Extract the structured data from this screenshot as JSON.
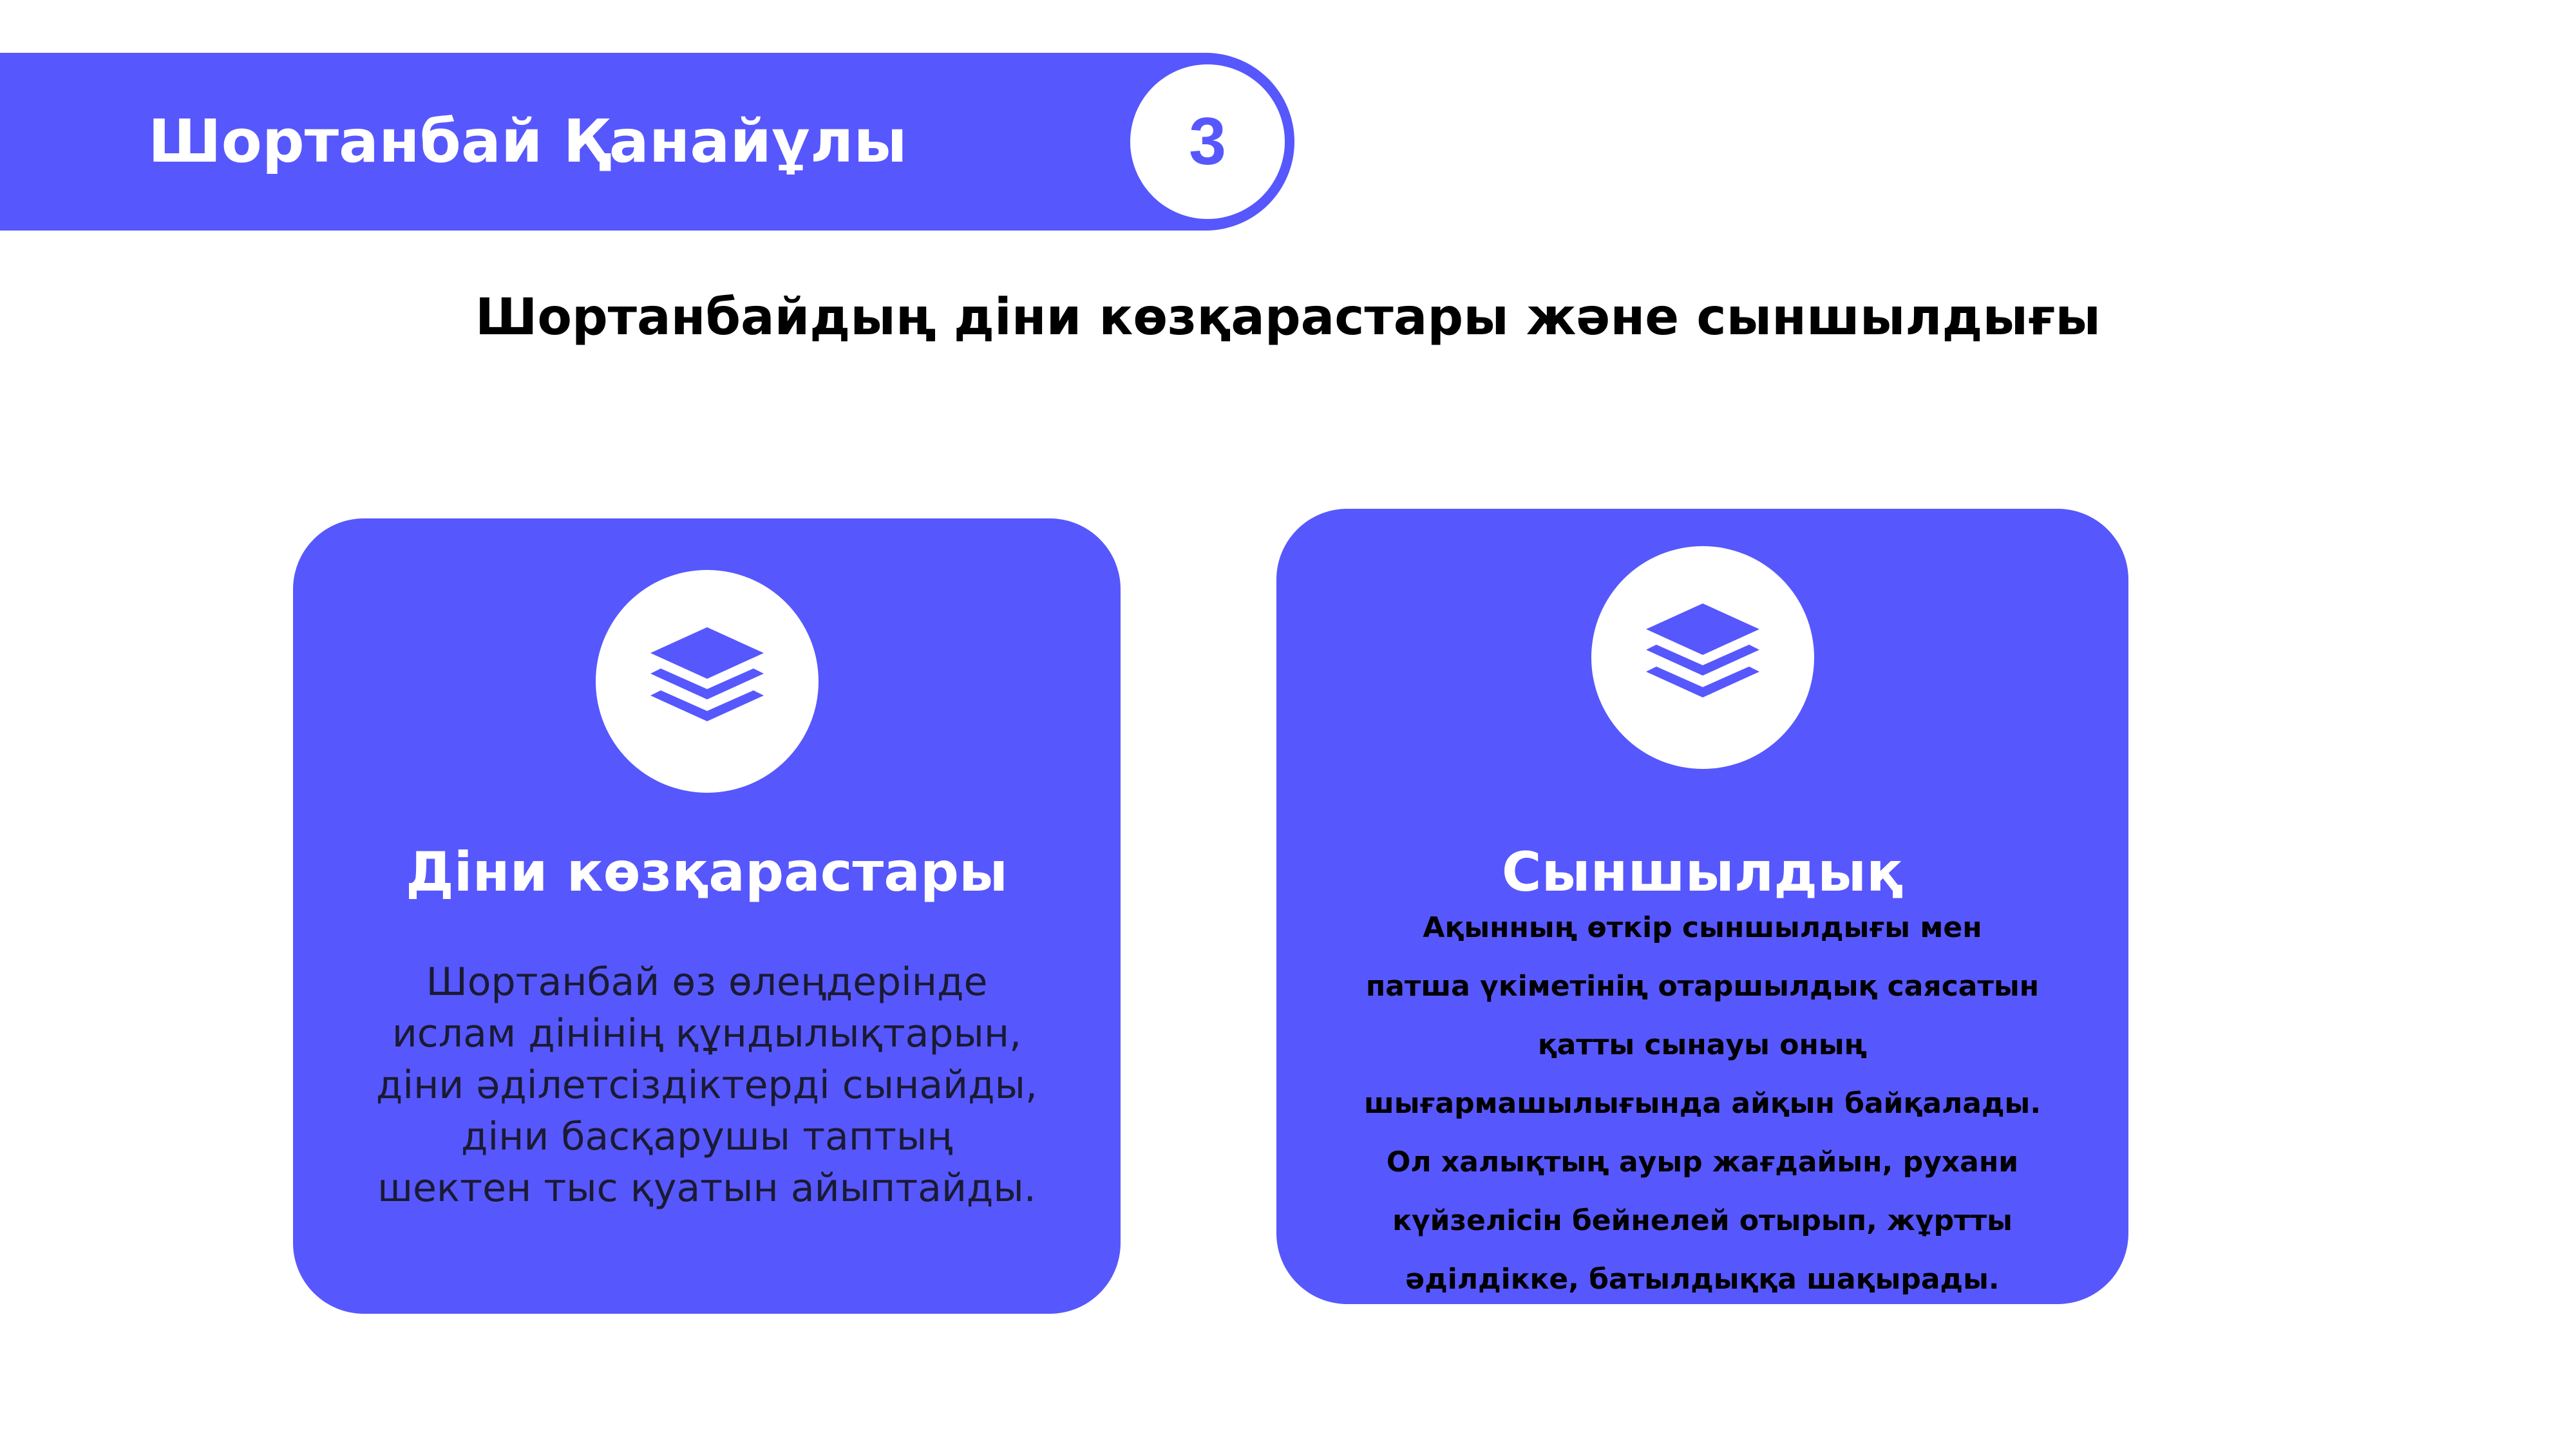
{
  "header": {
    "title": "Шортанбай Қанайұлы",
    "number": "3"
  },
  "subtitle": "Шортанбайдың діни көзқарастары және сыншылдығы",
  "cards": [
    {
      "icon": "layers-icon",
      "title": "Діни көзқарастары",
      "text_lines": [
        "Шортанбай өз өлеңдерінде",
        "ислам дінінің құндылықтарын,",
        "діни әділетсіздіктерді сынайды,",
        "діни басқарушы таптың",
        "шектен тыс қуатын айыптайды."
      ]
    },
    {
      "icon": "layers-icon",
      "title": "Сыншылдық",
      "text_lines": [
        "Ақынның өткір сыншылдығы мен",
        "патша үкіметінің отаршылдық саясатын",
        "қатты сынауы оның",
        "шығармашылығында айқын байқалады.",
        "Ол халықтың ауыр жағдайын, рухани",
        "күйзелісін бейнелей отырып, жұртты",
        "әділдікке, батылдыққа шақырады."
      ]
    }
  ],
  "colors": {
    "accent": "#5757fe",
    "background": "#ffffff",
    "text_dark": "#000000"
  }
}
